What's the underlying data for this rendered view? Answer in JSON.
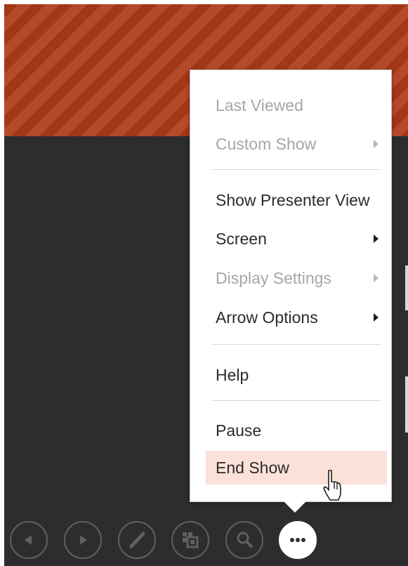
{
  "menu": {
    "items": [
      {
        "label": "Last Viewed",
        "disabled": true,
        "submenu": false
      },
      {
        "label": "Custom Show",
        "disabled": true,
        "submenu": true
      },
      {
        "label": "Show Presenter View",
        "disabled": false,
        "submenu": false
      },
      {
        "label": "Screen",
        "disabled": false,
        "submenu": true
      },
      {
        "label": "Display Settings",
        "disabled": true,
        "submenu": true
      },
      {
        "label": "Arrow Options",
        "disabled": false,
        "submenu": true
      },
      {
        "label": "Help",
        "disabled": false,
        "submenu": false
      },
      {
        "label": "Pause",
        "disabled": false,
        "submenu": false
      },
      {
        "label": "End Show",
        "disabled": false,
        "submenu": false,
        "highlighted": true
      }
    ]
  },
  "toolbar": {
    "buttons": [
      {
        "icon": "previous-icon"
      },
      {
        "icon": "next-icon"
      },
      {
        "icon": "pen-icon"
      },
      {
        "icon": "see-all-slides-icon"
      },
      {
        "icon": "zoom-icon"
      },
      {
        "icon": "more-options-icon",
        "active": true
      }
    ]
  },
  "colors": {
    "banner_stripe_dark": "#a33818",
    "banner_stripe_light": "#b54a2a",
    "slide_background": "#2d2d2d",
    "highlight": "#fbe1d8",
    "disabled_text": "#a6a6a6",
    "toolbar_outline": "#606060"
  }
}
